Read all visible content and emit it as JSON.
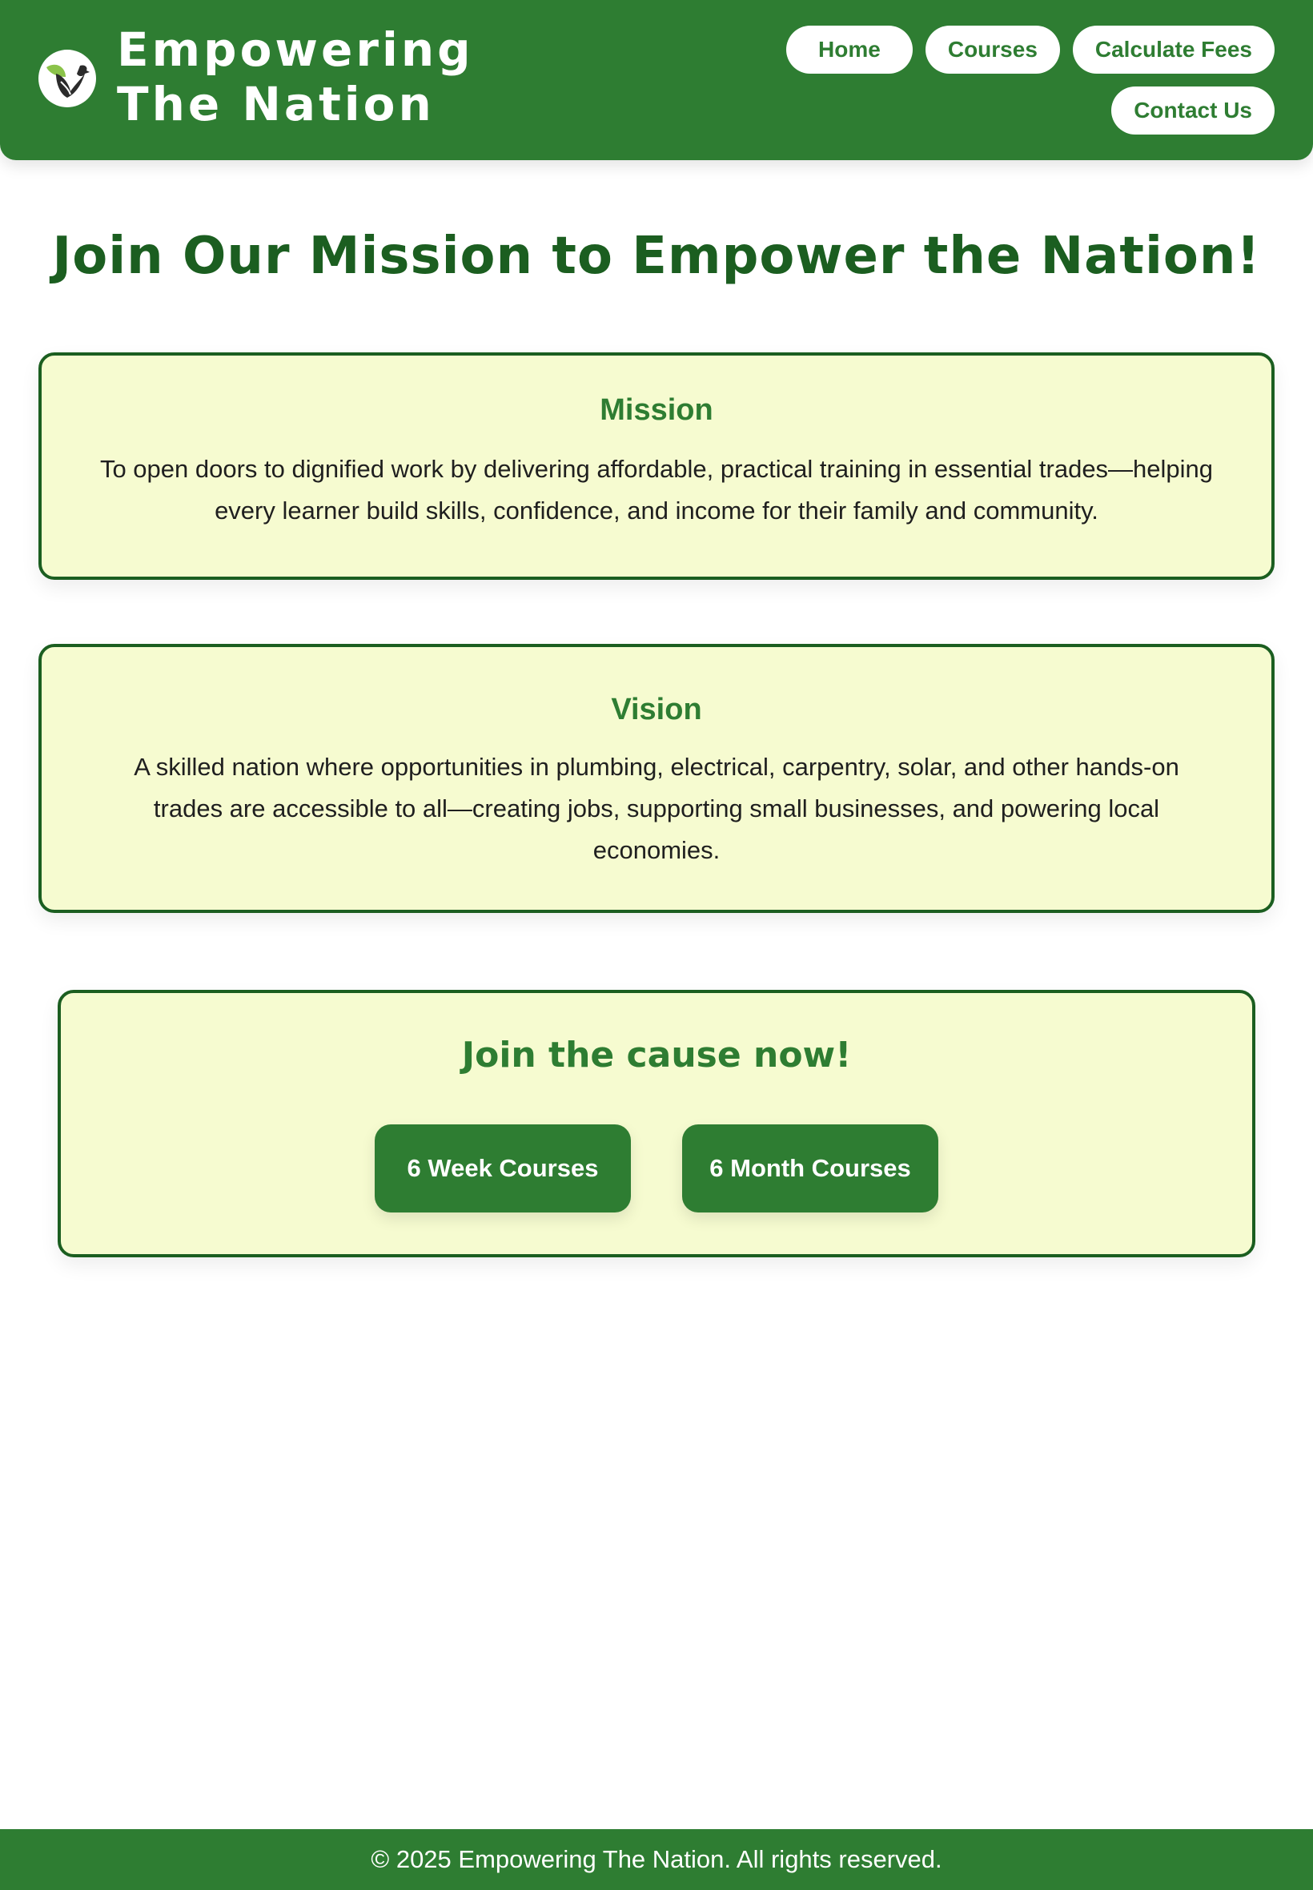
{
  "header": {
    "brand_title": "Empowering The Nation",
    "logo_icon": "dove-leaf-icon",
    "nav": [
      {
        "label": "Home"
      },
      {
        "label": "Courses"
      },
      {
        "label": "Calculate Fees"
      },
      {
        "label": "Contact Us"
      }
    ]
  },
  "main": {
    "page_title": "Join Our Mission to Empower the Nation!",
    "mission": {
      "heading": "Mission",
      "text": "To open doors to dignified work by delivering affordable, practical training in essential trades—helping every learner build skills, confidence, and income for their family and community."
    },
    "vision": {
      "heading": "Vision",
      "text": "A skilled nation where opportunities in plumbing, electrical, carpentry, solar, and other hands-on trades are accessible to all—creating jobs, supporting small businesses, and powering local economies."
    },
    "cta": {
      "heading": "Join the cause now!",
      "buttons": [
        {
          "label": "6 Week Courses"
        },
        {
          "label": "6 Month Courses"
        }
      ]
    }
  },
  "footer": {
    "text": "© 2025 Empowering The Nation. All rights reserved."
  },
  "colors": {
    "primary_green": "#2e7d32",
    "dark_green": "#1b5e20",
    "card_background": "#f6fbd0",
    "white": "#ffffff"
  }
}
